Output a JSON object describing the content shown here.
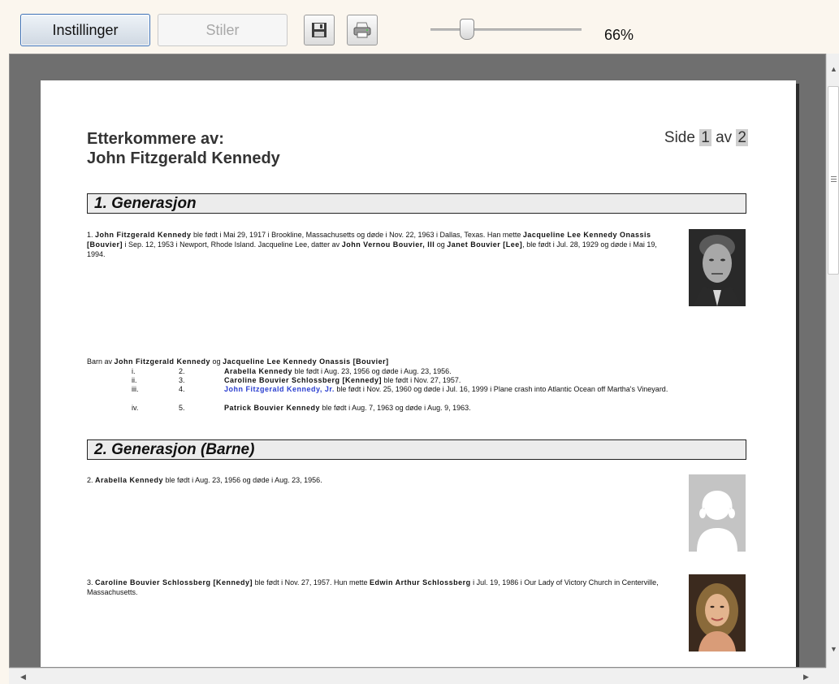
{
  "toolbar": {
    "settings_label": "Instillinger",
    "styles_label": "Stiler",
    "save_icon": "floppy-disk-icon",
    "print_icon": "printer-icon",
    "zoom": "66%"
  },
  "report": {
    "title_line1": "Etterkommere av:",
    "title_line2": "John Fitzgerald Kennedy",
    "page_prefix": "Side",
    "page_current": "1",
    "page_mid": "av",
    "page_total": "2",
    "gen1_title": "1. Generasjon",
    "p1_a": "1. ",
    "p1_name": "John Fitzgerald Kennedy",
    "p1_b": " ble født i Mai 29, 1917 i Brookline, Massachusetts og døde i Nov. 22, 1963 i Dallas, Texas. Han mette ",
    "p1_spouse": "Jacqueline Lee Kennedy Onassis [Bouvier]",
    "p1_c": " i Sep. 12, 1953 i Newport, Rhode Island. Jacqueline Lee, datter av ",
    "p1_father": "John Vernou Bouvier, III",
    "p1_d": " og ",
    "p1_mother": "Janet Bouvier [Lee]",
    "p1_e": ", ble født i Jul. 28, 1929 og døde i Mai 19, 1994.",
    "children_prefix": "Barn av ",
    "children_father": "John Fitzgerald Kennedy",
    "children_and": " og ",
    "children_mother": "Jacqueline Lee Kennedy Onassis [Bouvier]",
    "children": [
      {
        "roman": "i.",
        "num": "2.",
        "name": "Arabella Kennedy",
        "rest": " ble født i Aug. 23, 1956 og døde i Aug. 23, 1956."
      },
      {
        "roman": "ii.",
        "num": "3.",
        "name": "Caroline Bouvier Schlossberg [Kennedy]",
        "rest": " ble født i Nov. 27, 1957."
      },
      {
        "roman": "iii.",
        "num": "4.",
        "name": "John Fitzgerald Kennedy, Jr.",
        "rest": " ble født i Nov. 25, 1960 og døde i Jul. 16, 1999 i Plane crash into Atlantic Ocean off Martha's Vineyard."
      },
      {
        "roman": "iv.",
        "num": "5.",
        "name": "Patrick Bouvier Kennedy",
        "rest": " ble født i Aug. 7, 1963 og døde i Aug. 9, 1963."
      }
    ],
    "gen2_title": "2. Generasjon (Barne)",
    "p2_a": "2. ",
    "p2_name": "Arabella Kennedy",
    "p2_b": " ble født i Aug. 23, 1956 og døde i Aug. 23, 1956.",
    "p3_a": "3. ",
    "p3_name": "Caroline Bouvier Schlossberg [Kennedy]",
    "p3_b": " ble født i Nov. 27, 1957. Hun mette ",
    "p3_spouse": "Edwin Arthur Schlossberg",
    "p3_c": " i Jul. 19, 1986 i Our Lady of Victory Church in Centerville, Massachusetts."
  },
  "colors": {
    "background": "#fbf6ee",
    "viewer_bg": "#6f6f6f",
    "link": "#2b3fd0"
  }
}
